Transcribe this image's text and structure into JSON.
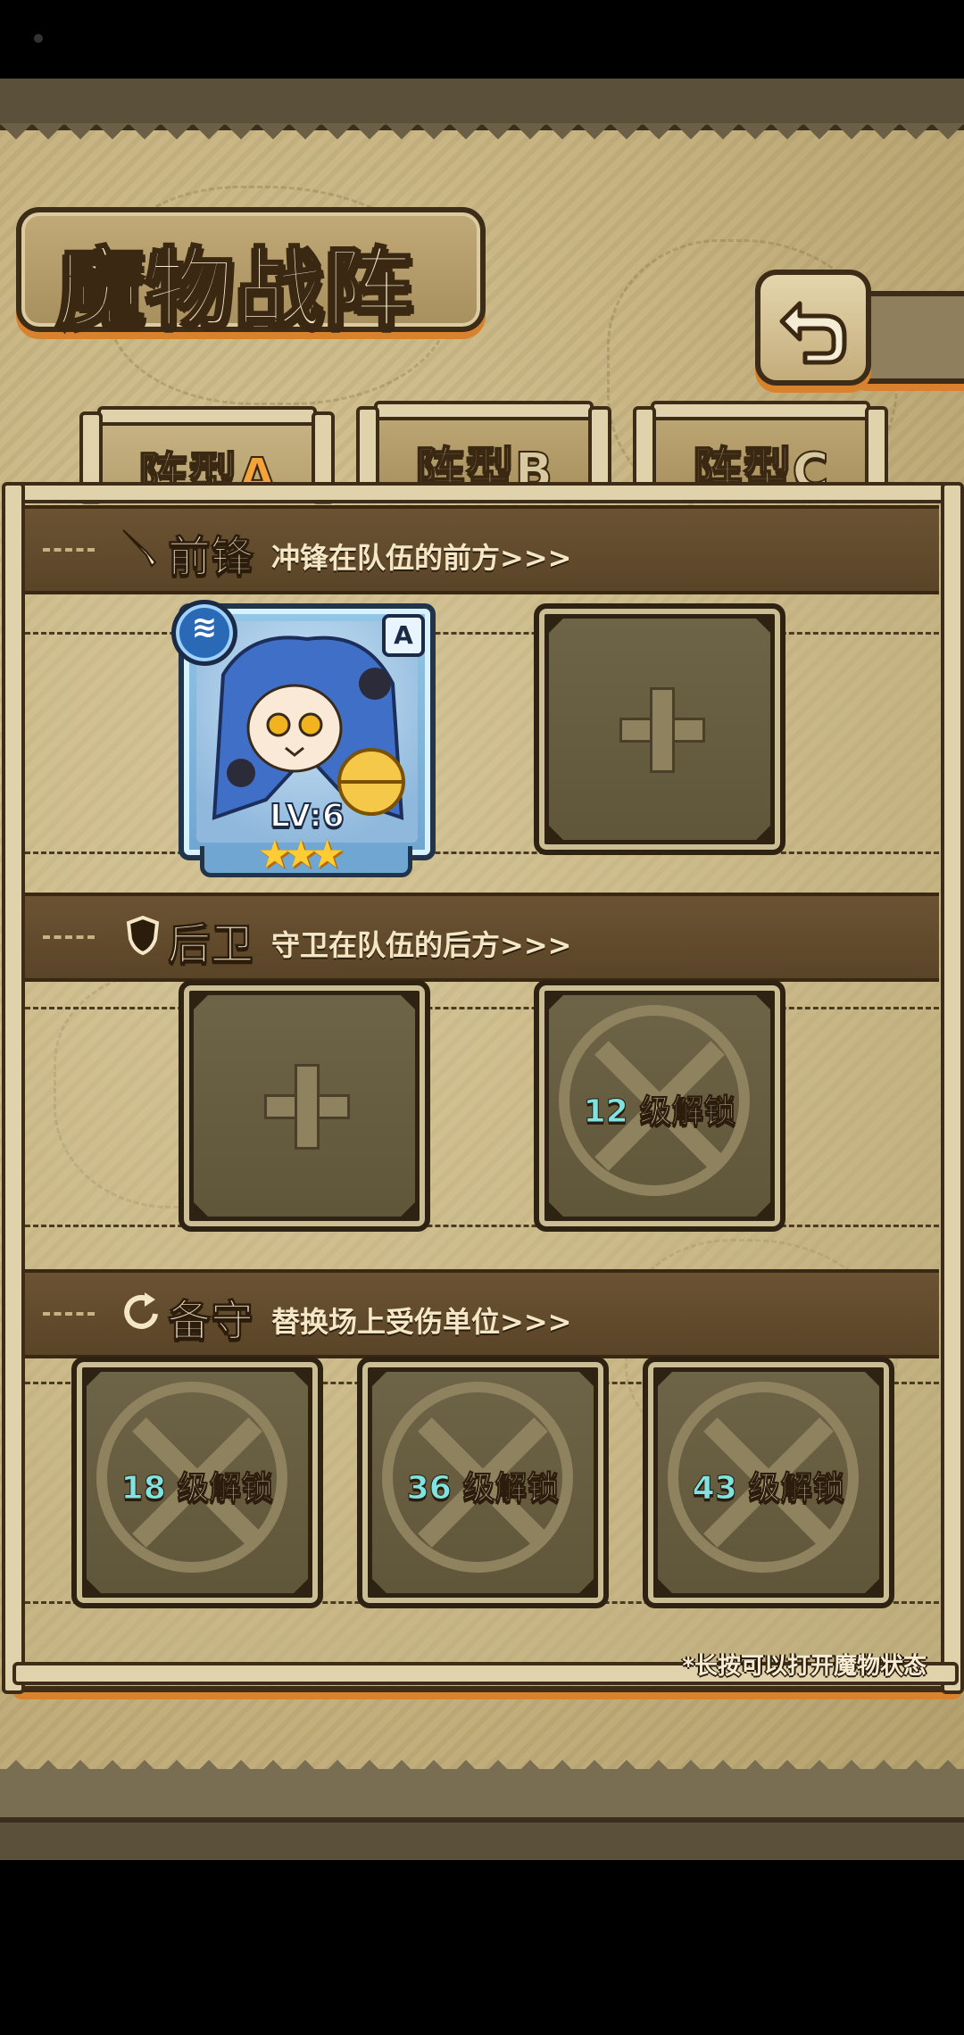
{
  "screen": {
    "title": "魔物战阵",
    "back_icon": "return-arrow-icon",
    "footer_hint": "*长按可以打开魔物状态"
  },
  "tabs": [
    {
      "prefix": "阵型",
      "letter": "A",
      "active": true
    },
    {
      "prefix": "阵型",
      "letter": "B",
      "active": false
    },
    {
      "prefix": "阵型",
      "letter": "C",
      "active": false
    }
  ],
  "sections": {
    "vanguard": {
      "title": "前锋",
      "subtitle": "冲锋在队伍的前方>>>",
      "icon": "sword-icon"
    },
    "rearguard": {
      "title": "后卫",
      "subtitle": "守卫在队伍的后方>>>",
      "icon": "shield-icon"
    },
    "reserve": {
      "title": "备守",
      "subtitle": "替换场上受伤单位>>>",
      "icon": "swap-arrows-icon"
    }
  },
  "monster": {
    "level": "LV:6",
    "rank": "A",
    "stars": 3,
    "element_icon": "water-element-icon"
  },
  "slots": {
    "vanguard_2": {
      "state": "empty"
    },
    "rearguard_1": {
      "state": "empty"
    },
    "rearguard_2": {
      "state": "locked",
      "level": "12",
      "suffix": "级解锁"
    },
    "reserve_1": {
      "state": "locked",
      "level": "18",
      "suffix": "级解锁"
    },
    "reserve_2": {
      "state": "locked",
      "level": "36",
      "suffix": "级解锁"
    },
    "reserve_3": {
      "state": "locked",
      "level": "43",
      "suffix": "级解锁"
    }
  },
  "colors": {
    "accent_orange": "#d9822d",
    "lock_level_cyan": "#7fe3e2",
    "parchment": "#c9b684"
  }
}
